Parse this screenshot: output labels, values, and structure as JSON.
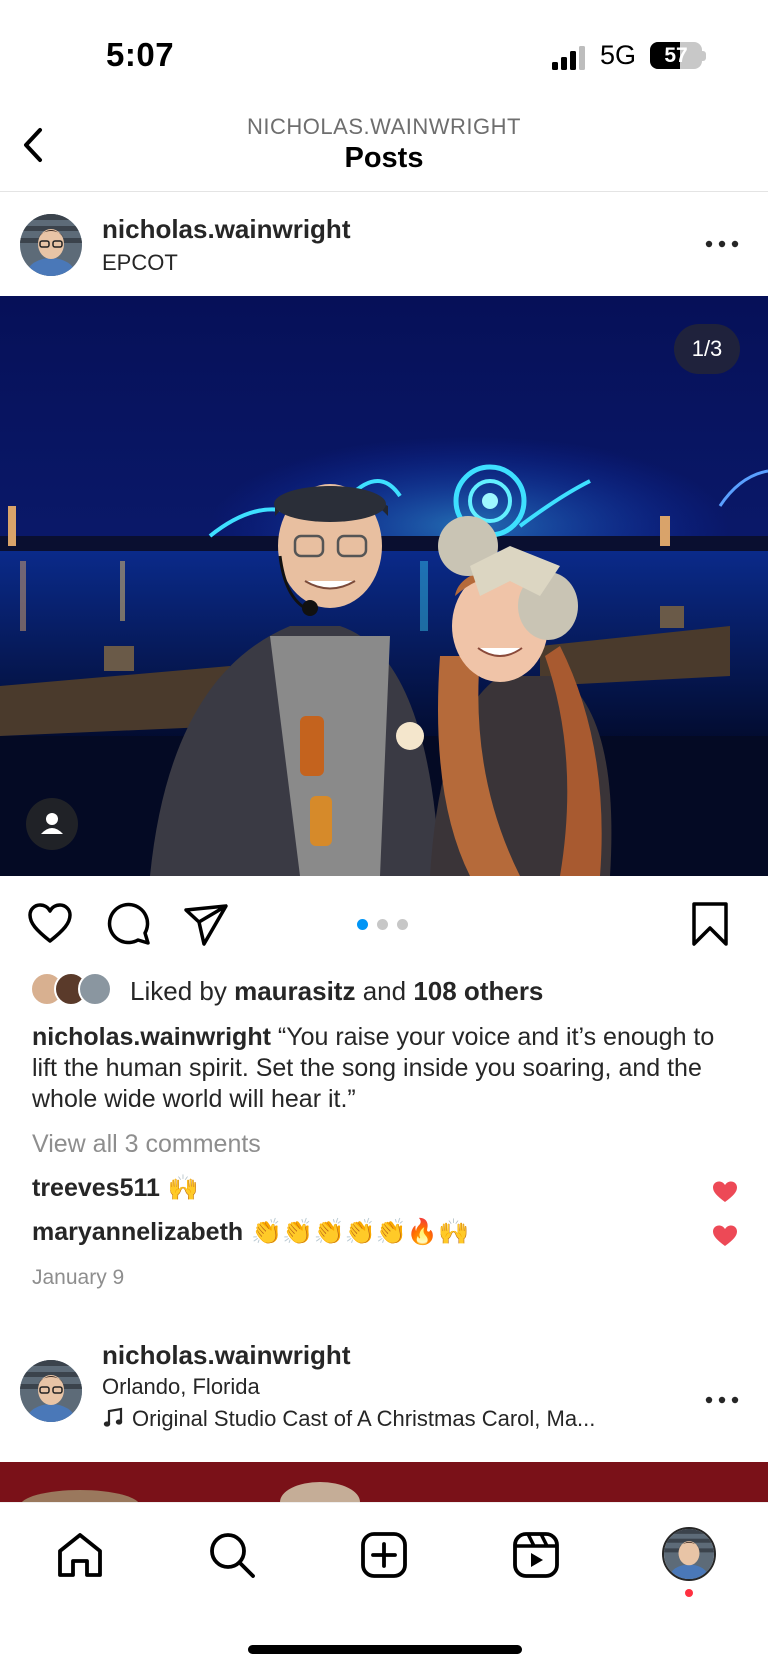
{
  "status_bar": {
    "time": "5:07",
    "network": "5G",
    "battery": "57",
    "battery_level": 0.57
  },
  "header": {
    "subtitle": "NICHOLAS.WAINWRIGHT",
    "title": "Posts"
  },
  "post": {
    "username": "nicholas.wainwright",
    "location": "EPCOT",
    "media_counter": "1/3",
    "media_count": 3,
    "media_index": 1,
    "likes": {
      "prefix": "Liked by",
      "first_liker": "maurasitz",
      "joiner": "and",
      "others": "108 others"
    },
    "caption_user": "nicholas.wainwright",
    "caption_text": "“You raise your voice and it’s enough to lift the human spirit. Set the song inside you soaring, and the whole wide world will hear it.”",
    "view_comments": "View all 3 comments",
    "comments": [
      {
        "user": "treeves511",
        "text": "🙌",
        "liked": true
      },
      {
        "user": "maryannelizabeth",
        "text": "👏👏👏👏👏🔥🙌",
        "liked": true
      }
    ],
    "date": "January 9"
  },
  "next_post": {
    "username": "nicholas.wainwright",
    "location": "Orlando, Florida",
    "music": "Original Studio Cast of A Christmas Carol, Ma..."
  },
  "colors": {
    "accent": "#0095f6",
    "like_red": "#ed4956",
    "notification": "#ff3040"
  },
  "icons": {
    "nav": [
      "home-icon",
      "search-icon",
      "create-icon",
      "reels-icon",
      "profile-avatar"
    ],
    "post_actions": [
      "like-icon",
      "comment-icon",
      "share-icon",
      "save-icon"
    ]
  }
}
